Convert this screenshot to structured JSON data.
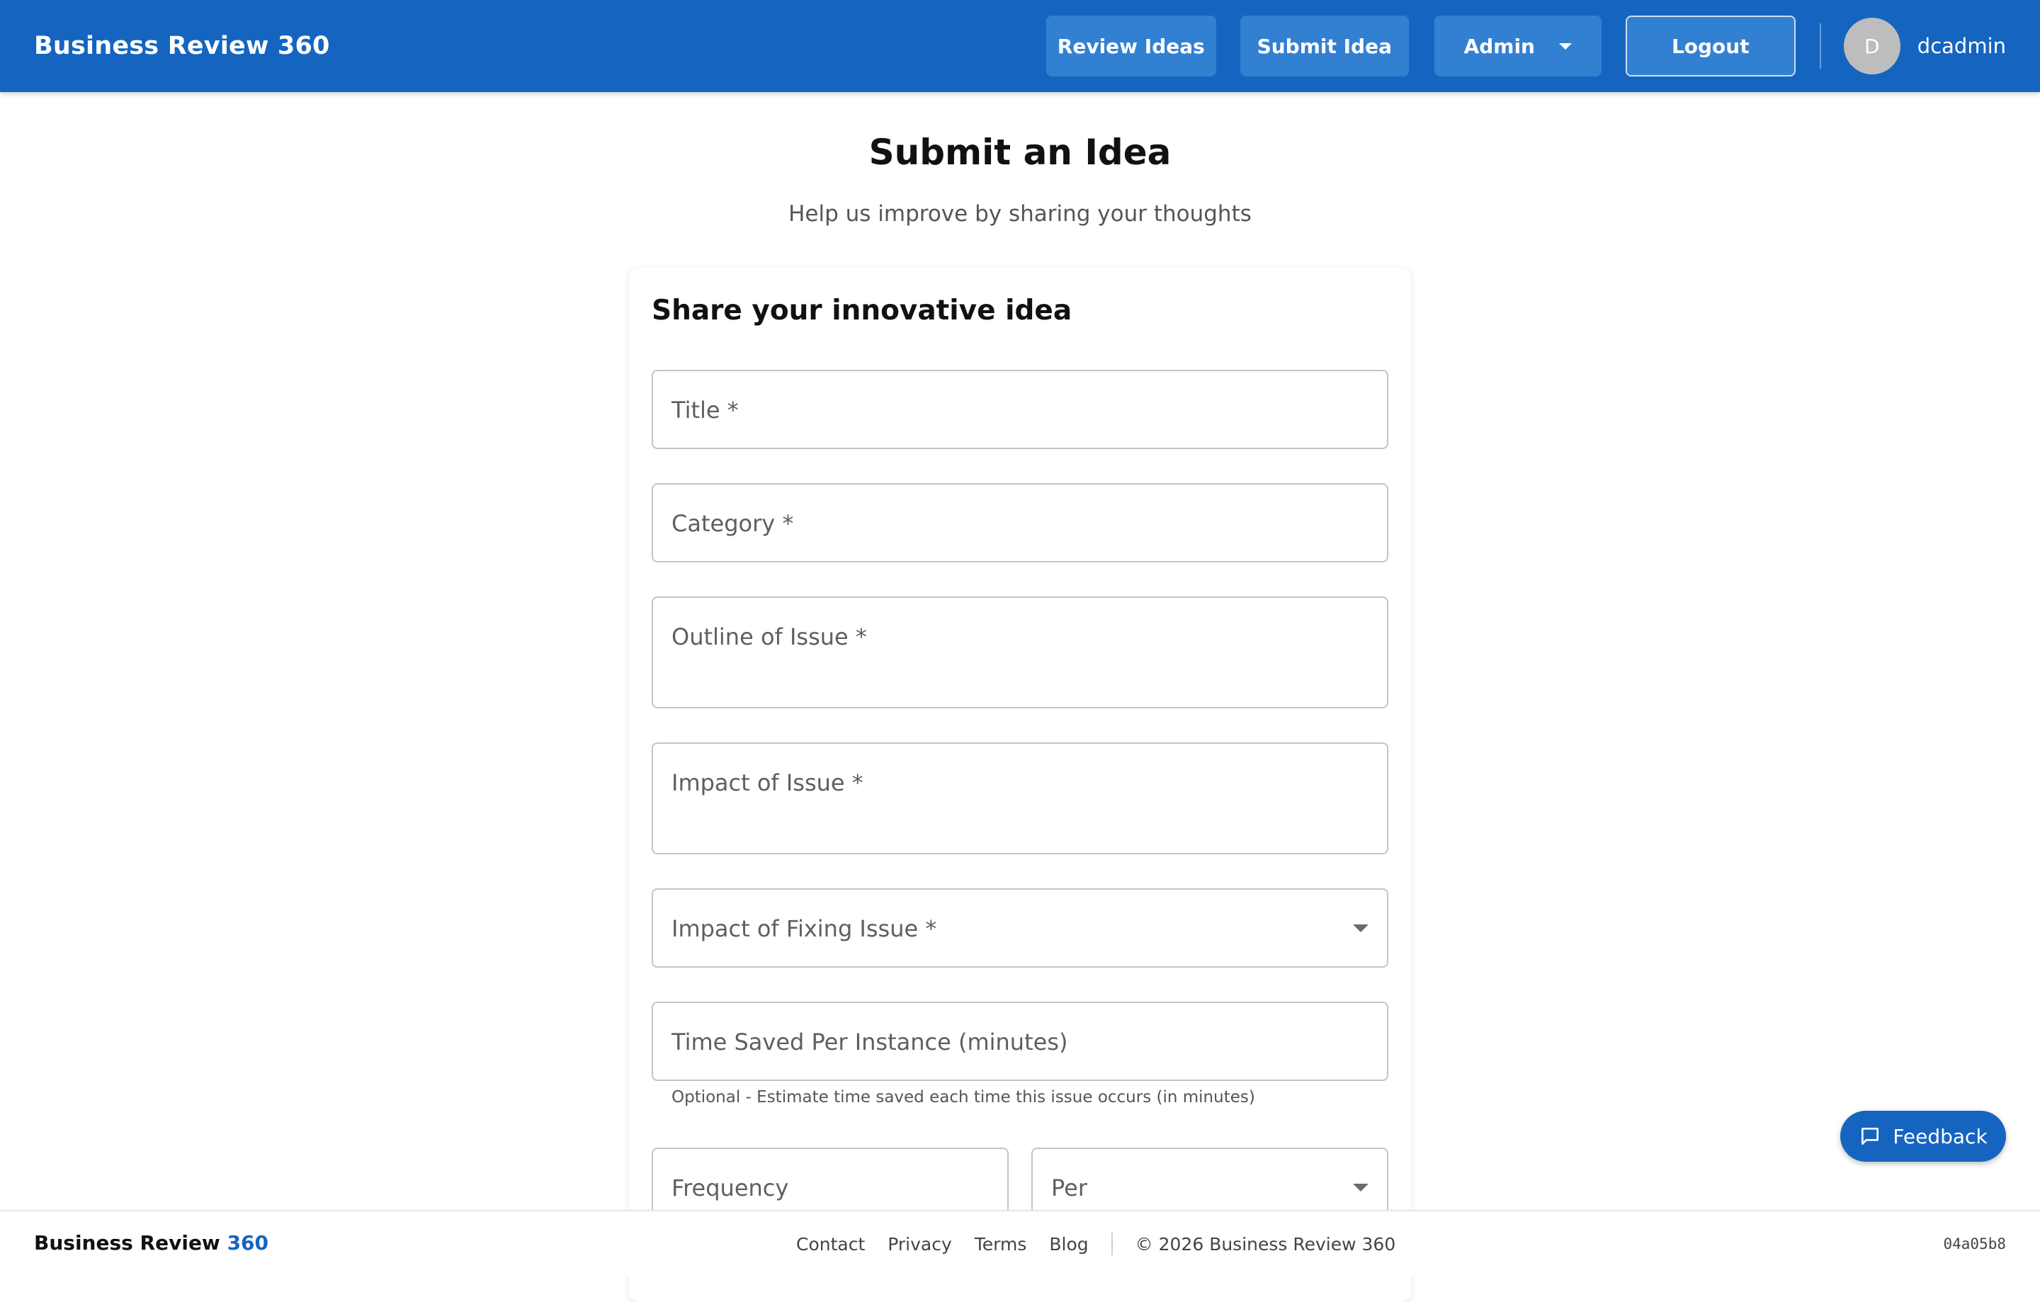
{
  "header": {
    "brand": "Business Review 360",
    "nav": {
      "review_ideas": "Review Ideas",
      "submit_idea": "Submit Idea",
      "admin": "Admin",
      "logout": "Logout"
    },
    "user": {
      "initial": "D",
      "name": "dcadmin"
    }
  },
  "page": {
    "title": "Submit an Idea",
    "subtitle": "Help us improve by sharing your thoughts"
  },
  "form": {
    "heading": "Share your innovative idea",
    "fields": {
      "title": "Title *",
      "category": "Category *",
      "outline": "Outline of Issue *",
      "impact": "Impact of Issue *",
      "impact_fixing": "Impact of Fixing Issue *",
      "time_saved": "Time Saved Per Instance (minutes)",
      "time_saved_helper": "Optional - Estimate time saved each time this issue occurs (in minutes)",
      "frequency": "Frequency",
      "per": "Per"
    }
  },
  "feedback": {
    "label": "Feedback",
    "icon": "chat-bubble-icon"
  },
  "footer": {
    "brand_main": "Business Review",
    "brand_accent": "360",
    "links": [
      "Contact",
      "Privacy",
      "Terms",
      "Blog"
    ],
    "copyright": "© 2026 Business Review 360",
    "build": "04a05b8"
  },
  "colors": {
    "primary": "#1565c0",
    "nav_button": "#3280d2",
    "field_border": "#c4c4c4"
  }
}
